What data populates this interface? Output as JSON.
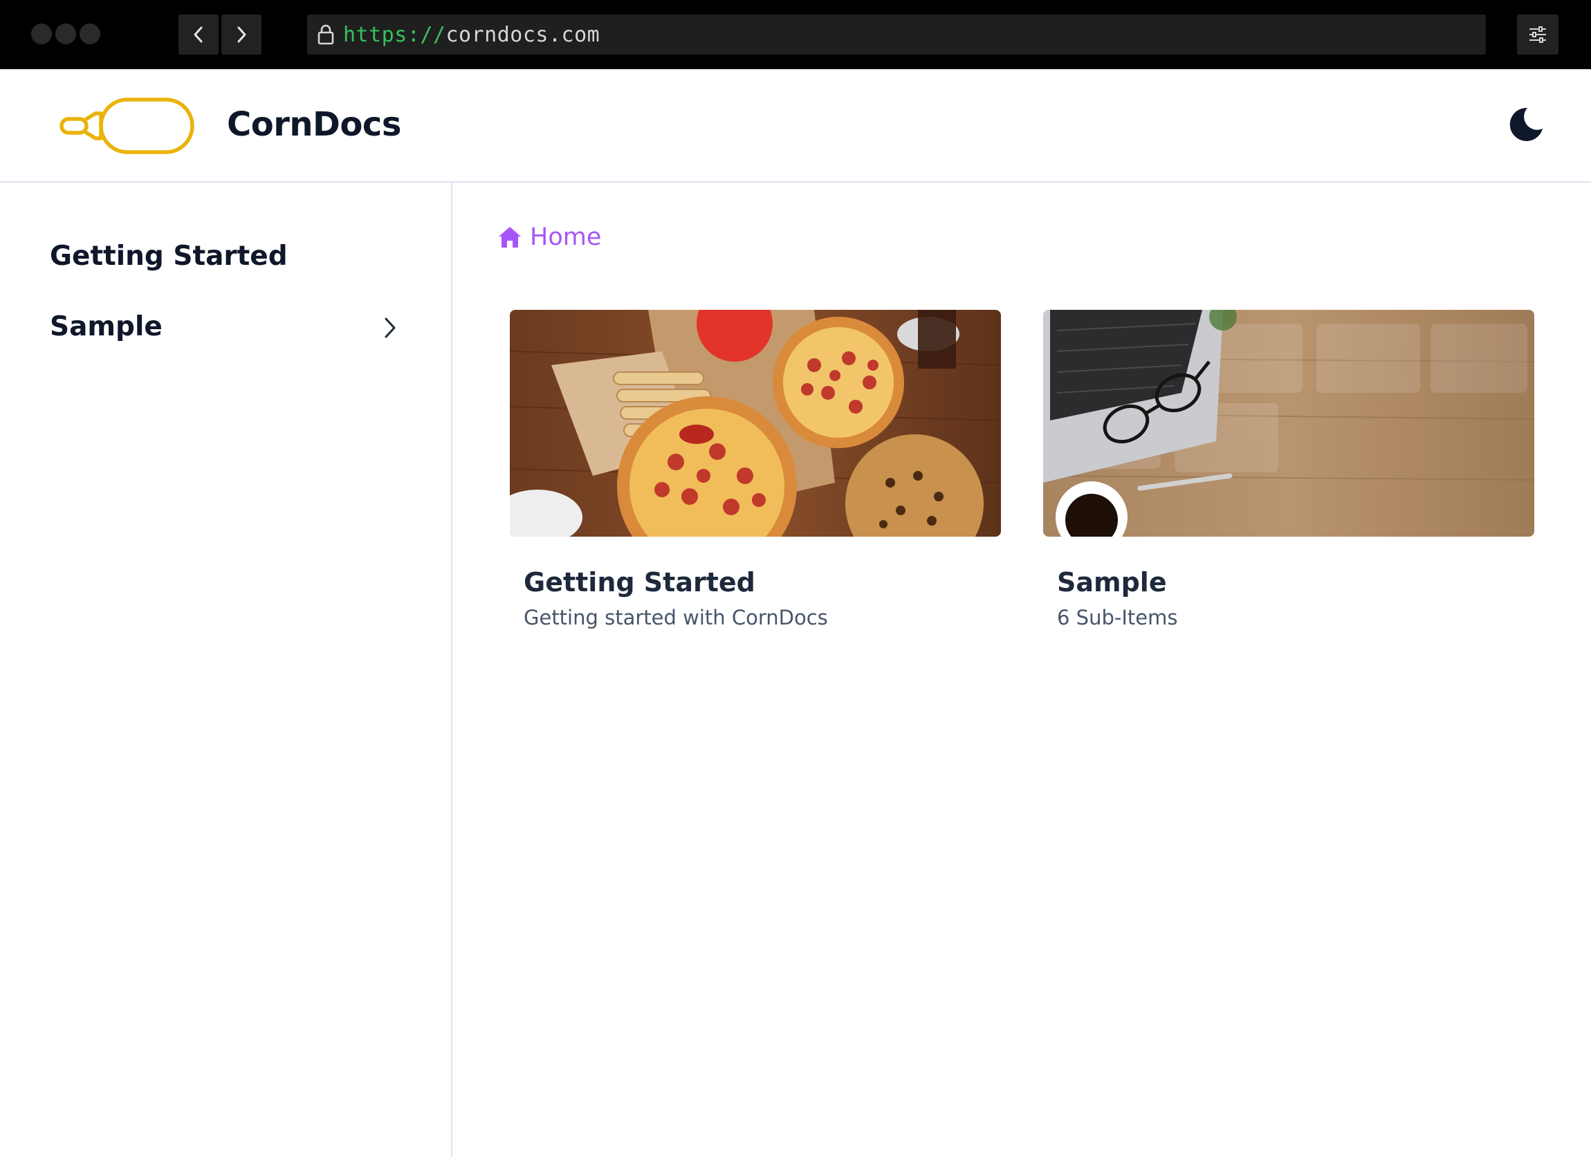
{
  "browser": {
    "url_scheme": "https://",
    "url_host": "corndocs.com"
  },
  "header": {
    "brand": "CornDocs"
  },
  "sidebar": {
    "items": [
      {
        "label": "Getting Started"
      },
      {
        "label": "Sample"
      }
    ]
  },
  "breadcrumb": {
    "label": "Home"
  },
  "cards": [
    {
      "title": "Getting Started",
      "subtitle": "Getting started with CornDocs"
    },
    {
      "title": "Sample",
      "subtitle": "6 Sub-Items"
    }
  ],
  "colors": {
    "accent": "#a855f7",
    "logo": "#eab308",
    "text": "#0f172a"
  }
}
